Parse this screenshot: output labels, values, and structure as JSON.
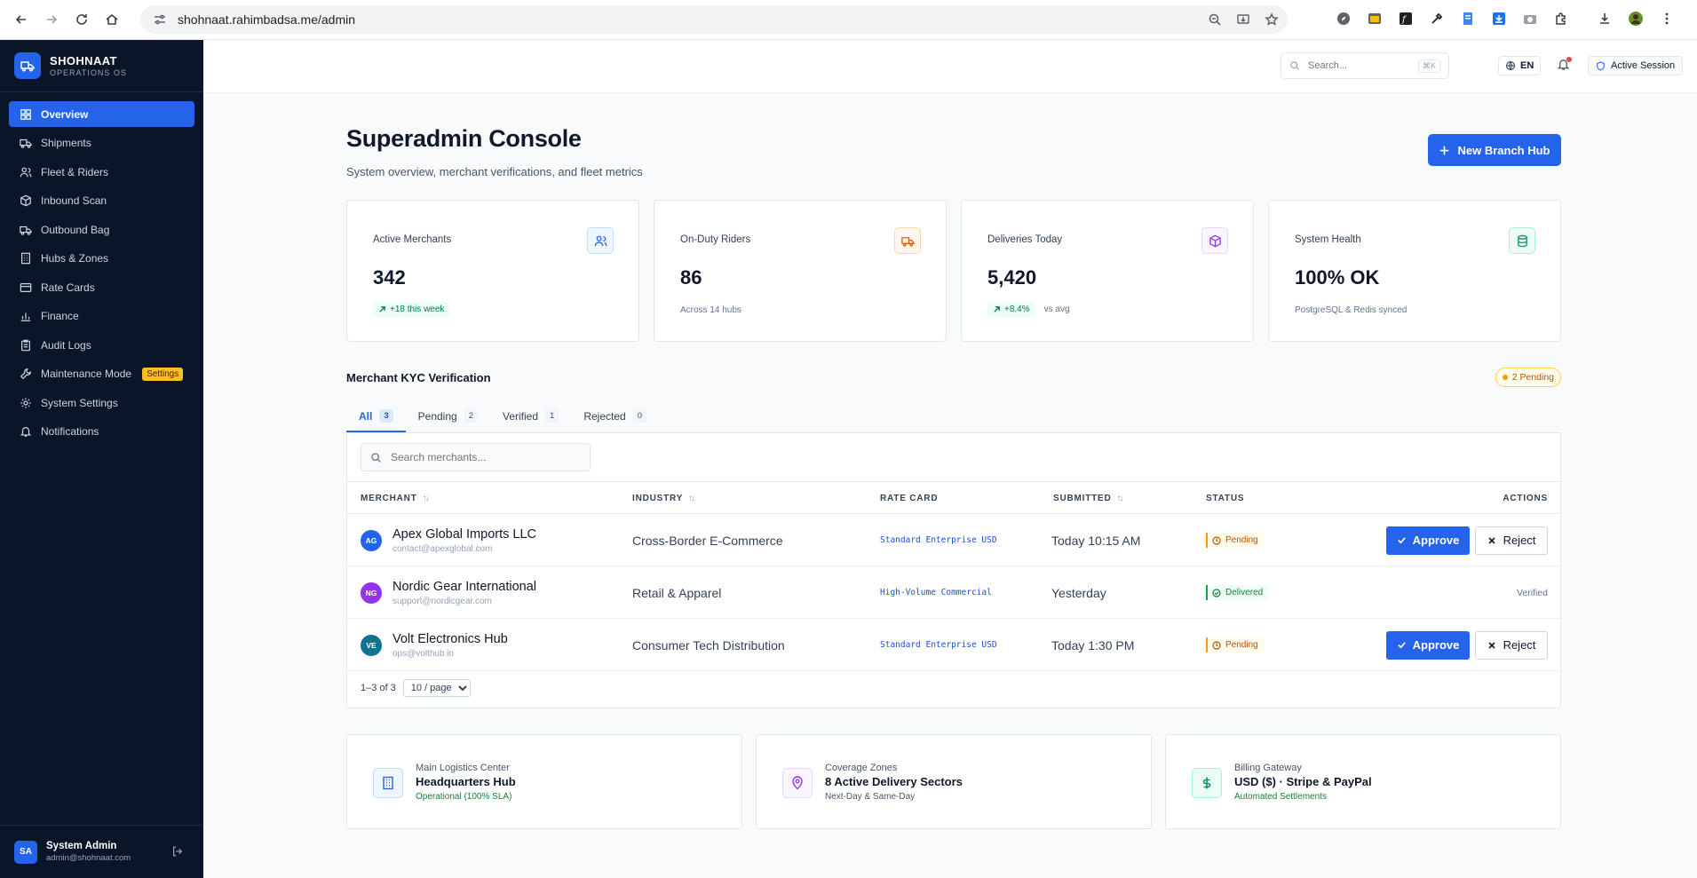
{
  "browser": {
    "url": "shohnaat.rahimbadsa.me/admin"
  },
  "sidebar": {
    "brand_name": "SHOHNAAT",
    "brand_sub": "OPERATIONS OS",
    "items": [
      {
        "label": "Overview",
        "icon": "grid-icon",
        "active": true
      },
      {
        "label": "Shipments",
        "icon": "truck-icon"
      },
      {
        "label": "Fleet & Riders",
        "icon": "users-icon"
      },
      {
        "label": "Inbound Scan",
        "icon": "box-icon"
      },
      {
        "label": "Outbound Bag",
        "icon": "truck-icon"
      },
      {
        "label": "Hubs & Zones",
        "icon": "building-icon"
      },
      {
        "label": "Rate Cards",
        "icon": "card-icon"
      },
      {
        "label": "Finance",
        "icon": "bar-chart-icon"
      },
      {
        "label": "Audit Logs",
        "icon": "clipboard-icon"
      },
      {
        "label": "Maintenance Mode",
        "icon": "wrench-icon",
        "badge": "Settings"
      },
      {
        "label": "System Settings",
        "icon": "gear-icon"
      },
      {
        "label": "Notifications",
        "icon": "bell-icon"
      }
    ],
    "user": {
      "initials": "SA",
      "name": "System Admin",
      "email": "admin@shohnaat.com"
    }
  },
  "topbar": {
    "search_placeholder": "Search...",
    "shortcut": "⌘K",
    "language": "EN",
    "session_label": "Active Session"
  },
  "header": {
    "title": "Superadmin Console",
    "subtitle": "System overview, merchant verifications, and fleet metrics",
    "new_hub_label": "New Branch Hub"
  },
  "stats": [
    {
      "label": "Active Merchants",
      "value": "342",
      "trend": "+18 this week",
      "note": "",
      "icon": "users-icon",
      "accent": "#2563eb"
    },
    {
      "label": "On-Duty Riders",
      "value": "86",
      "trend": "",
      "note": "Across 14 hubs",
      "icon": "truck-icon",
      "accent": "#ea580c"
    },
    {
      "label": "Deliveries Today",
      "value": "5,420",
      "trend": "+8.4%",
      "note": "vs avg",
      "icon": "box-icon",
      "accent": "#9333ea"
    },
    {
      "label": "System Health",
      "value": "100% OK",
      "trend": "",
      "note": "PostgreSQL & Redis synced",
      "icon": "database-icon",
      "accent": "#059669"
    }
  ],
  "kyc": {
    "title": "Merchant KYC Verification",
    "pending_badge": "2 Pending",
    "tabs": [
      {
        "label": "All",
        "count": "3",
        "active": true
      },
      {
        "label": "Pending",
        "count": "2"
      },
      {
        "label": "Verified",
        "count": "1"
      },
      {
        "label": "Rejected",
        "count": "0"
      }
    ],
    "search_placeholder": "Search merchants...",
    "columns": [
      "MERCHANT",
      "INDUSTRY",
      "RATE CARD",
      "SUBMITTED",
      "STATUS",
      "ACTIONS"
    ],
    "rows": [
      {
        "initials": "AG",
        "avatar_color": "#2563eb",
        "name": "Apex Global Imports LLC",
        "email": "contact@apexglobal.com",
        "industry": "Cross-Border E-Commerce",
        "rate_card": "Standard Enterprise USD",
        "submitted": "Today 10:15 AM",
        "status": "Pending",
        "status_kind": "pending",
        "actions": true
      },
      {
        "initials": "NG",
        "avatar_color": "#9333ea",
        "name": "Nordic Gear International",
        "email": "support@nordicgear.com",
        "industry": "Retail & Apparel",
        "rate_card": "High-Volume Commercial",
        "submitted": "Yesterday",
        "status": "Delivered",
        "status_kind": "delivered",
        "actions": false,
        "action_text": "Verified"
      },
      {
        "initials": "VE",
        "avatar_color": "#0e7490",
        "name": "Volt Electronics Hub",
        "email": "ops@volthub.io",
        "industry": "Consumer Tech Distribution",
        "rate_card": "Standard Enterprise USD",
        "submitted": "Today 1:30 PM",
        "status": "Pending",
        "status_kind": "pending",
        "actions": true
      }
    ],
    "approve_label": "Approve",
    "reject_label": "Reject",
    "range_text": "1–3 of 3",
    "per_page": "10 / page"
  },
  "bottom_cards": [
    {
      "label": "Main Logistics Center",
      "title": "Headquarters Hub",
      "sub": "Operational (100% SLA)",
      "sub_color": "#15803d",
      "icon": "building-icon",
      "accent": "#2563eb"
    },
    {
      "label": "Coverage Zones",
      "title": "8 Active Delivery Sectors",
      "sub": "Next-Day & Same-Day",
      "sub_color": "#475569",
      "icon": "map-pin-icon",
      "accent": "#9333ea"
    },
    {
      "label": "Billing Gateway",
      "title": "USD ($) · Stripe & PayPal",
      "sub": "Automated Settlements",
      "sub_color": "#15803d",
      "icon": "dollar-icon",
      "accent": "#059669"
    }
  ]
}
